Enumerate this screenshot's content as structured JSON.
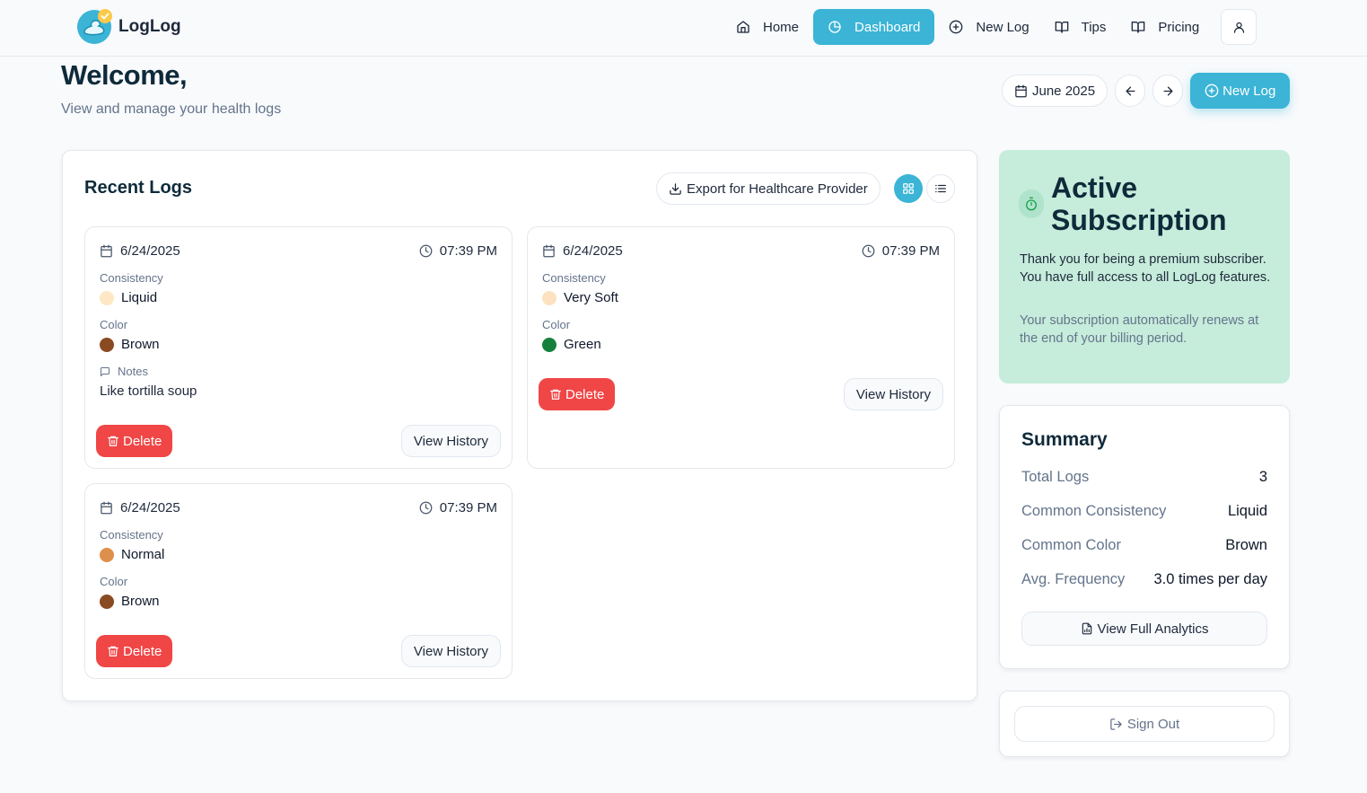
{
  "app": {
    "name": "LogLog"
  },
  "nav": {
    "items": [
      {
        "label": "Home",
        "icon": "home-icon",
        "active": false
      },
      {
        "label": "Dashboard",
        "icon": "dashboard-icon",
        "active": true
      },
      {
        "label": "New Log",
        "icon": "plus-circle-icon",
        "active": false
      },
      {
        "label": "Tips",
        "icon": "book-icon",
        "active": false
      },
      {
        "label": "Pricing",
        "icon": "book-icon",
        "active": false
      }
    ],
    "user_icon": "user-icon"
  },
  "header": {
    "welcome": "Welcome,",
    "subtitle": "View and manage your health logs",
    "month": "June 2025",
    "new_log": "New Log"
  },
  "recent_logs": {
    "title": "Recent Logs",
    "export_label": "Export for Healthcare Provider",
    "labels": {
      "consistency": "Consistency",
      "color": "Color",
      "notes": "Notes",
      "delete": "Delete",
      "view_history": "View History"
    },
    "logs": [
      {
        "date": "6/24/2025",
        "time": "07:39 PM",
        "consistency": "Liquid",
        "consistency_color": "#fde7c4",
        "color": "Brown",
        "color_hex": "#8a4a22",
        "notes": "Like tortilla soup"
      },
      {
        "date": "6/24/2025",
        "time": "07:39 PM",
        "consistency": "Very Soft",
        "consistency_color": "#fde2c0",
        "color": "Green",
        "color_hex": "#15803d"
      },
      {
        "date": "6/24/2025",
        "time": "07:39 PM",
        "consistency": "Normal",
        "consistency_color": "#df8f4c",
        "color": "Brown",
        "color_hex": "#8a4a22"
      }
    ]
  },
  "subscription": {
    "title": "Active Subscription",
    "text": "Thank you for being a premium subscriber. You have full access to all LogLog features.",
    "note": "Your subscription automatically renews at the end of your billing period."
  },
  "summary": {
    "title": "Summary",
    "rows": [
      {
        "label": "Total Logs",
        "value": "3"
      },
      {
        "label": "Common Consistency",
        "value": "Liquid"
      },
      {
        "label": "Common Color",
        "value": "Brown"
      },
      {
        "label": "Avg. Frequency",
        "value": "3.0 times per day"
      }
    ],
    "analytics_label": "View Full Analytics"
  },
  "sign_out": "Sign Out",
  "colors": {
    "accent": "#3bb4d6",
    "danger": "#f04646",
    "subscription_bg": "#c6ecdb"
  }
}
